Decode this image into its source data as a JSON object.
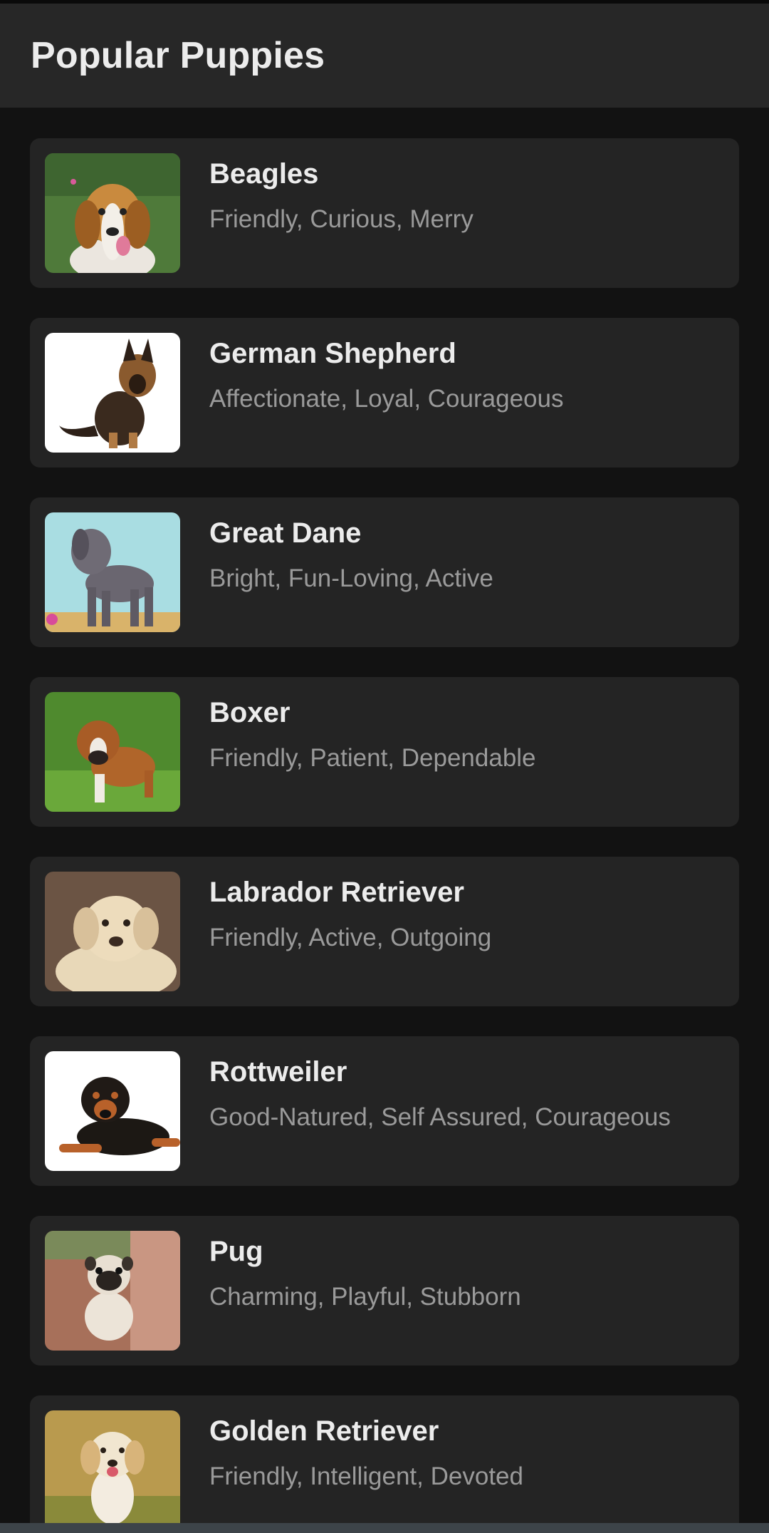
{
  "app_bar": {
    "title": "Popular Puppies"
  },
  "colors": {
    "background": "#121212",
    "app_bar": "#272727",
    "card": "#242424",
    "title_text": "#ececec",
    "subtitle_text": "#9a9a9a"
  },
  "puppies": [
    {
      "name": "Beagles",
      "traits": "Friendly, Curious, Merry",
      "photo": "beagle-photo"
    },
    {
      "name": "German Shepherd",
      "traits": "Affectionate, Loyal, Courageous",
      "photo": "german-shepherd-photo"
    },
    {
      "name": "Great Dane",
      "traits": "Bright, Fun-Loving, Active",
      "photo": "great-dane-photo"
    },
    {
      "name": "Boxer",
      "traits": "Friendly, Patient, Dependable",
      "photo": "boxer-photo"
    },
    {
      "name": "Labrador Retriever",
      "traits": "Friendly, Active, Outgoing",
      "photo": "labrador-photo"
    },
    {
      "name": "Rottweiler",
      "traits": "Good-Natured, Self Assured, Courageous",
      "photo": "rottweiler-photo"
    },
    {
      "name": "Pug",
      "traits": "Charming, Playful, Stubborn",
      "photo": "pug-photo"
    },
    {
      "name": "Golden Retriever",
      "traits": "Friendly, Intelligent, Devoted",
      "photo": "golden-retriever-photo"
    }
  ]
}
